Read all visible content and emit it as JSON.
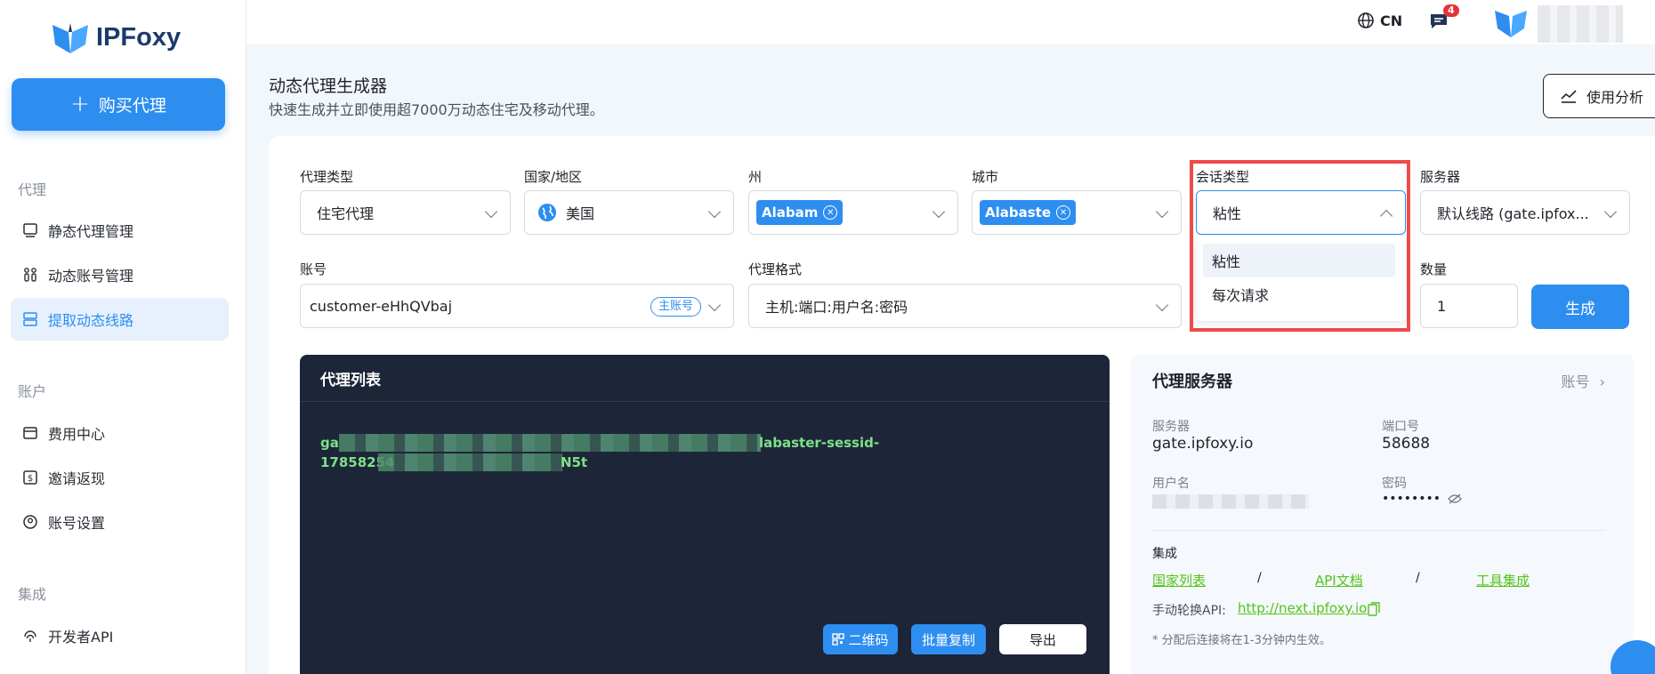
{
  "sidebar": {
    "logo": "IPFoxy",
    "buy_button": "购买代理",
    "sections": [
      "代理",
      "账户",
      "集成"
    ],
    "items": [
      {
        "label": "静态代理管理",
        "icon": "monitor-icon"
      },
      {
        "label": "动态账号管理",
        "icon": "users-icon"
      },
      {
        "label": "提取动态线路",
        "icon": "server-icon",
        "active": true
      },
      {
        "label": "费用中心",
        "icon": "wallet-icon"
      },
      {
        "label": "邀请返现",
        "icon": "dollar-icon"
      },
      {
        "label": "账号设置",
        "icon": "user-circle-icon"
      },
      {
        "label": "开发者API",
        "icon": "fingerprint-icon"
      }
    ]
  },
  "topbar": {
    "lang": "CN",
    "notification_count": "4"
  },
  "header": {
    "title": "动态代理生成器",
    "subtitle": "快速生成并立即使用超7000万动态住宅及移动代理。",
    "analytics_button": "使用分析"
  },
  "form": {
    "proxy_type": {
      "label": "代理类型",
      "value": "住宅代理"
    },
    "country": {
      "label": "国家/地区",
      "value": "美国"
    },
    "state": {
      "label": "州",
      "tag": "Alabam"
    },
    "city": {
      "label": "城市",
      "tag": "Alabaste"
    },
    "session": {
      "label": "会话类型",
      "value": "粘性",
      "options": [
        "粘性",
        "每次请求"
      ]
    },
    "server": {
      "label": "服务器",
      "value": "默认线路 (gate.ipfox..."
    },
    "account": {
      "label": "账号",
      "value": "customer-eHhQVbaj",
      "badge": "主账号"
    },
    "format": {
      "label": "代理格式",
      "value": "主机:端口:用户名:密码"
    },
    "quantity": {
      "label": "数量",
      "value": "1"
    },
    "generate_button": "生成"
  },
  "proxy_list": {
    "title": "代理列表",
    "line1_start": "ga",
    "line1_end": "labaster-sessid-",
    "line2_start": "17858254",
    "line2_end": "N5t",
    "buttons": {
      "qr": "二维码",
      "copy": "批量复制",
      "export": "导出"
    }
  },
  "server_info": {
    "title": "代理服务器",
    "account_link": "账号",
    "server_label": "服务器",
    "server_value": "gate.ipfoxy.io",
    "port_label": "端口号",
    "port_value": "58688",
    "username_label": "用户名",
    "password_label": "密码",
    "password_value": "••••••••",
    "integration_title": "集成",
    "links": [
      "国家列表",
      "API文档",
      "工具集成"
    ],
    "separator": "/",
    "rotate_label": "手动轮换API:",
    "rotate_url": "http://next.ipfoxy.io",
    "note": "* 分配后连接将在1-3分钟内生效。"
  }
}
